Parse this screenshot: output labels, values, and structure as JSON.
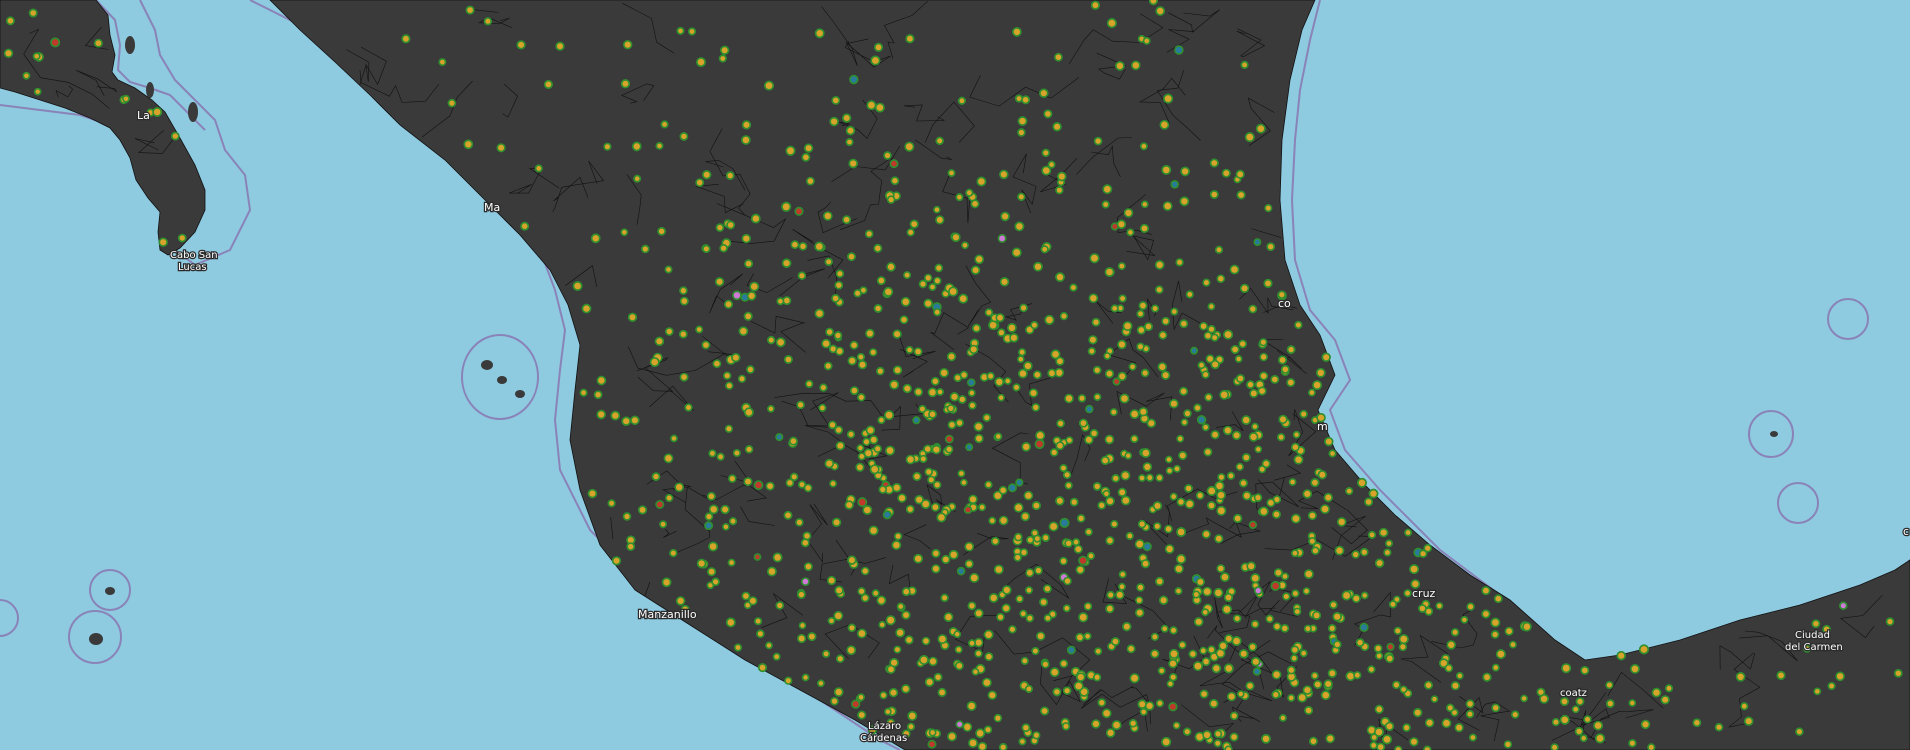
{
  "map": {
    "colors": {
      "ocean": "#8ecae0",
      "land": "#3a3a3a",
      "border": "#111111",
      "shoreline_buffer": "#8a83b8",
      "marker_fill": "#d8a32b",
      "marker_ring": "#2f8f2f",
      "marker_alt_blue": "#2a7a9e",
      "marker_alt_red": "#c0392b",
      "marker_alt_pink": "#d07ad8"
    },
    "labels": {
      "la_paz": "La",
      "cabo_san_lucas_1": "Cabo San",
      "cabo_san_lucas_2": "Lucas",
      "mazatlan": "Ma",
      "tampico": "co",
      "manzanillo": "Manzanillo",
      "lazaro_cardenas_1": "Lázaro",
      "lazaro_cardenas_2": "Cárdenas",
      "veracruz": "cruz",
      "ciudad_del_carmen_1": "Ciudad",
      "ciudad_del_carmen_2": "del Carmen",
      "coatzacoalcos": "coatz",
      "poza_rica": "m",
      "campeche_edge": "c"
    },
    "point_symbol": "green-ringed-orange-dot"
  }
}
